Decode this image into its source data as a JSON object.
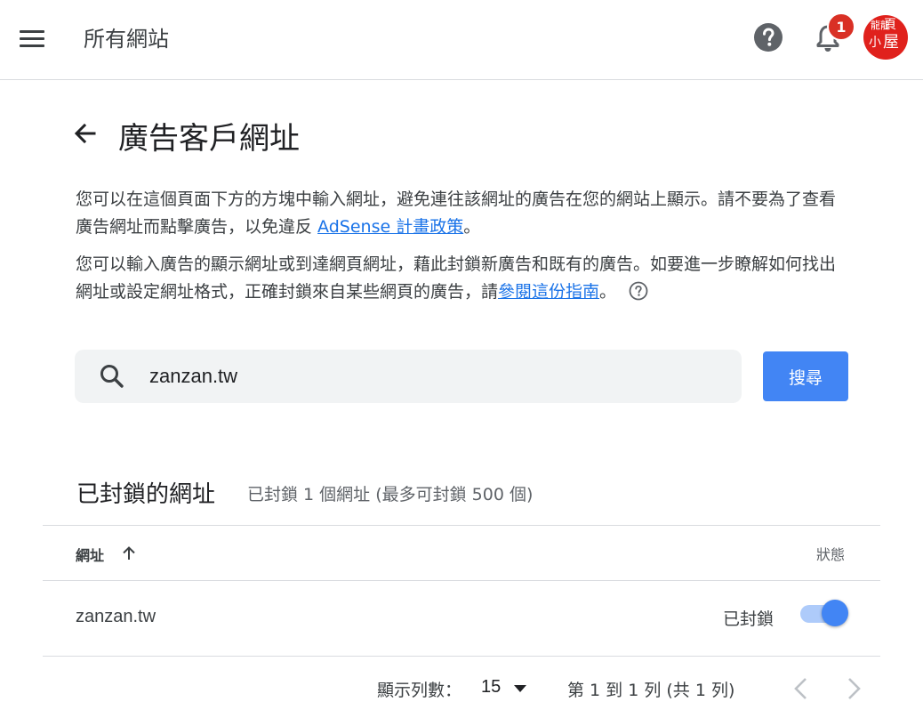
{
  "header": {
    "title": "所有網站",
    "notification_count": "1",
    "avatar_text": [
      "龍龍",
      "頁",
      "小",
      "屋"
    ]
  },
  "page": {
    "title": "廣告客戶網址",
    "desc1_text": "您可以在這個頁面下方的方塊中輸入網址，避免連往該網址的廣告在您的網站上顯示。請不要為了查看廣告網址而點擊廣告，以免違反 ",
    "desc1_link": "AdSense 計畫政策",
    "desc1_end": "。",
    "desc2_text": "您可以輸入廣告的顯示網址或到達網頁網址，藉此封鎖新廣告和既有的廣告。如要進一步瞭解如何找出網址或設定網址格式，正確封鎖來自某些網頁的廣告，請",
    "desc2_link": "參閱這份指南",
    "desc2_end": "。"
  },
  "search": {
    "value": "zanzan.tw",
    "button_label": "搜尋"
  },
  "blocked": {
    "title": "已封鎖的網址",
    "subtitle": "已封鎖 1 個網址 (最多可封鎖 500 個)",
    "columns": {
      "url": "網址",
      "status": "狀態"
    },
    "rows": [
      {
        "url": "zanzan.tw",
        "status": "已封鎖",
        "enabled": true
      }
    ]
  },
  "pagination": {
    "rows_label": "顯示列數：",
    "rows_value": "15",
    "range_text": "第 1 到 1 列 (共 1 列)"
  },
  "colors": {
    "accent": "#4285f4",
    "link": "#1a73e8",
    "badge": "#d93025",
    "avatar": "#e0211c"
  }
}
